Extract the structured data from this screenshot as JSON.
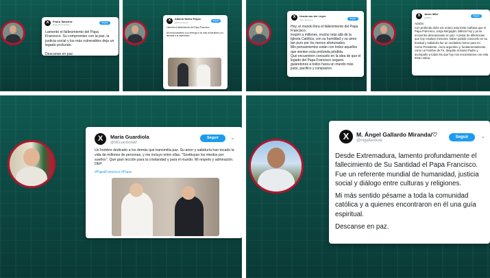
{
  "follow_label": "Seguir",
  "tweets": [
    {
      "name": "Pedro Sánchez",
      "handle": "@sanchezcastejon",
      "text": "Lamento el fallecimiento del Papa Francisco. Su compromiso con la paz, la justicia social y los más vulnerables deja un legado profundo.\n\nDescanse en paz."
    },
    {
      "name": "Alberto Núñez Feijóo",
      "handle": "@NunezFeijoo",
      "text": "Lamento el fallecimiento del Papa Francisco.\n\nMi reconocimiento a su entrega a los más vulnerables y su llamada a la esperanza."
    },
    {
      "name": "Ursula von der Leyen",
      "handle": "@vonderleyen",
      "text": "Hoy, el mundo llora el fallecimiento del Papa Francisco.\nInspiró a millones, mucho más allá de la Iglesia Católica, con su humildad y su amor tan puro por los menos afortunados.\nMis pensamientos están con todos aquellos que sienten esta profunda pérdida.\nQue encuentren consuelo en la idea de que el legado del Papa Francisco seguirá guiándonos a todos hacia un mundo más justo, pacífico y compasivo."
    },
    {
      "name": "Javier Milei",
      "handle": "@JMilei",
      "text": "ADIÓS\nCon profundo dolor me entero esta triste mañana que el Papa Francisco, Jorge Bergoglio, falleció hoy y ya se encuentra descansando en paz. A pesar de diferencias que hoy resultan menores, haber podido conocerlo en su bondad y sabiduría fue un verdadero honor para mí.\nComo Presidente, como argentino y, fundamentalmente, como un hombre de Fe, despido al Santo Padre y acompaño a todos los que hoy nos encontramos con esta triste noticia."
    },
    {
      "name": "María Guardiola",
      "handle": "@MGuardiolaM",
      "text": "Un hombre dedicado a los demás que transmitía paz. Su amor y sabiduría han tocado la vida de millones de personas, y me incluyo entre ellas. \"Sostituyan los miedos por sueños\". Qué gran lección para la cristiandad y para el mundo. Mi respeto y admiración. DEP",
      "hashtags": "#PapaFrancisco #Papa"
    },
    {
      "name": "M. Ángel Gallardo Miranda/♡",
      "handle": "@mgallardore",
      "p1": "Desde Extremadura, lamento profundamente el fallecimiento de Su Santidad el Papa Francisco. Fue un referente mundial de humanidad, justicia social y diálogo entre culturas y religiones.",
      "p2": "Mi más sentido pésame a toda la comunidad católica y a quienes encontraron en él una guía espiritual.",
      "p3": "Descanse en paz."
    }
  ]
}
